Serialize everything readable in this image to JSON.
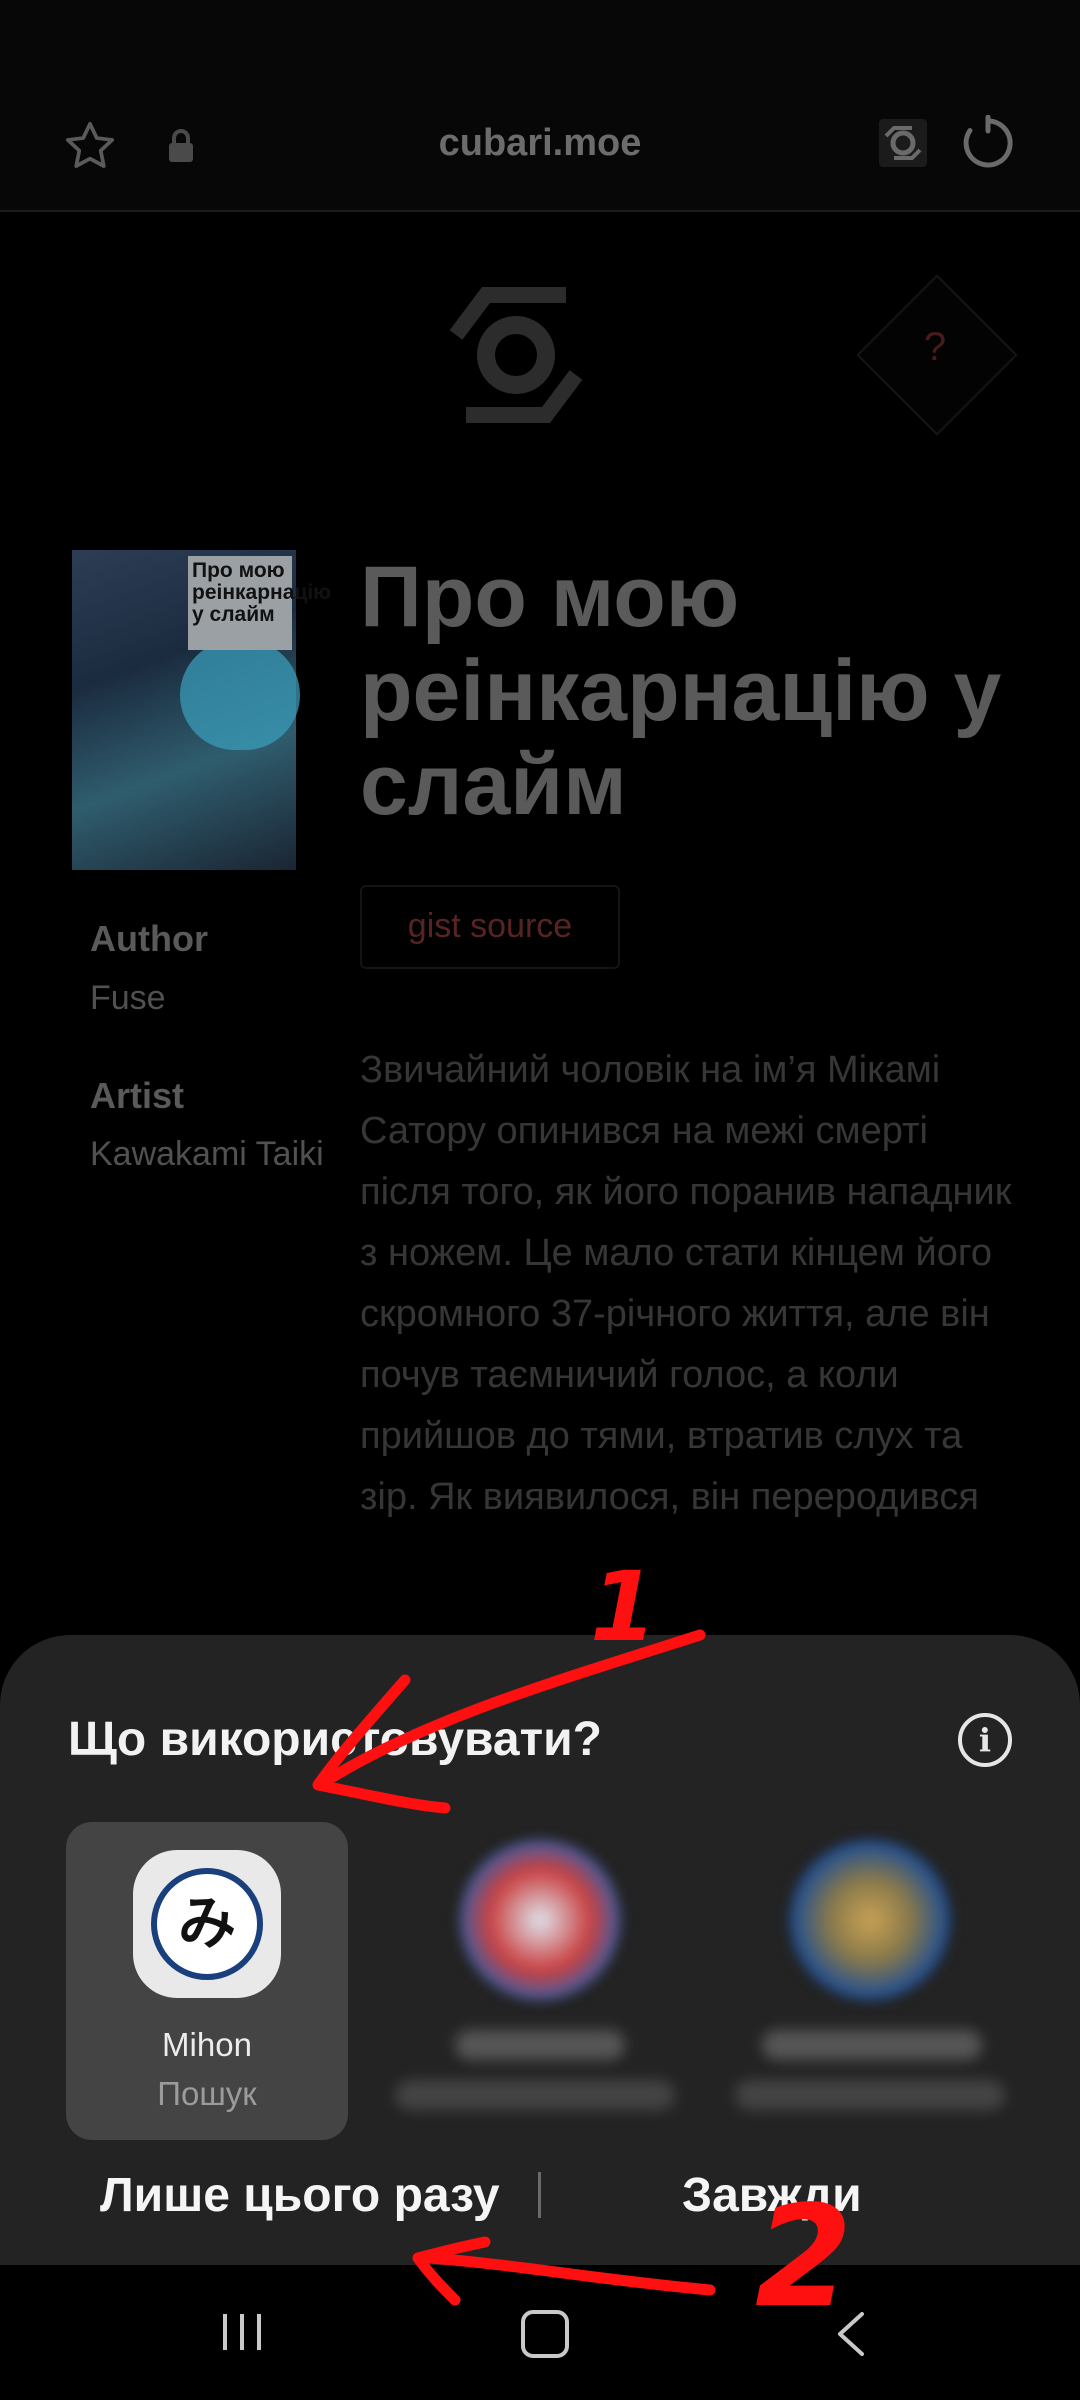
{
  "browser": {
    "url": "cubari.moe",
    "icons": [
      "star-icon",
      "lock-icon",
      "cubari-extension-icon",
      "reload-icon"
    ]
  },
  "page": {
    "help_label": "?",
    "cover_text": "Про мою реінкарнацію у слайм",
    "title": "Про мою реінкарнацію у слайм",
    "source_button": "gist source",
    "author_heading": "Author",
    "author_value": "Fuse",
    "artist_heading": "Artist",
    "artist_value": "Kawakami Taiki",
    "description": "Звичайний чоловік на ім’я Мікамі Сатору опинився на межі смерті після того, як його поранив нападник з ножем. Це мало стати кінцем його скромного 37-річного життя, але він почув таємничий голос, а коли прийшов до тями, втратив слух та зір. Як виявилося, він переродився"
  },
  "chooser": {
    "title": "Що використовувати?",
    "info_icon": "i",
    "apps": [
      {
        "name": "Mihon",
        "subtitle": "Пошук",
        "glyph": "み",
        "selected": true
      }
    ],
    "just_once": "Лише цього разу",
    "always": "Завжди"
  },
  "annotations": {
    "marker_1": "1",
    "marker_2": "2",
    "color": "#ff0000"
  },
  "navbar": {
    "icons": [
      "recent-apps-icon",
      "home-icon",
      "back-icon"
    ]
  }
}
